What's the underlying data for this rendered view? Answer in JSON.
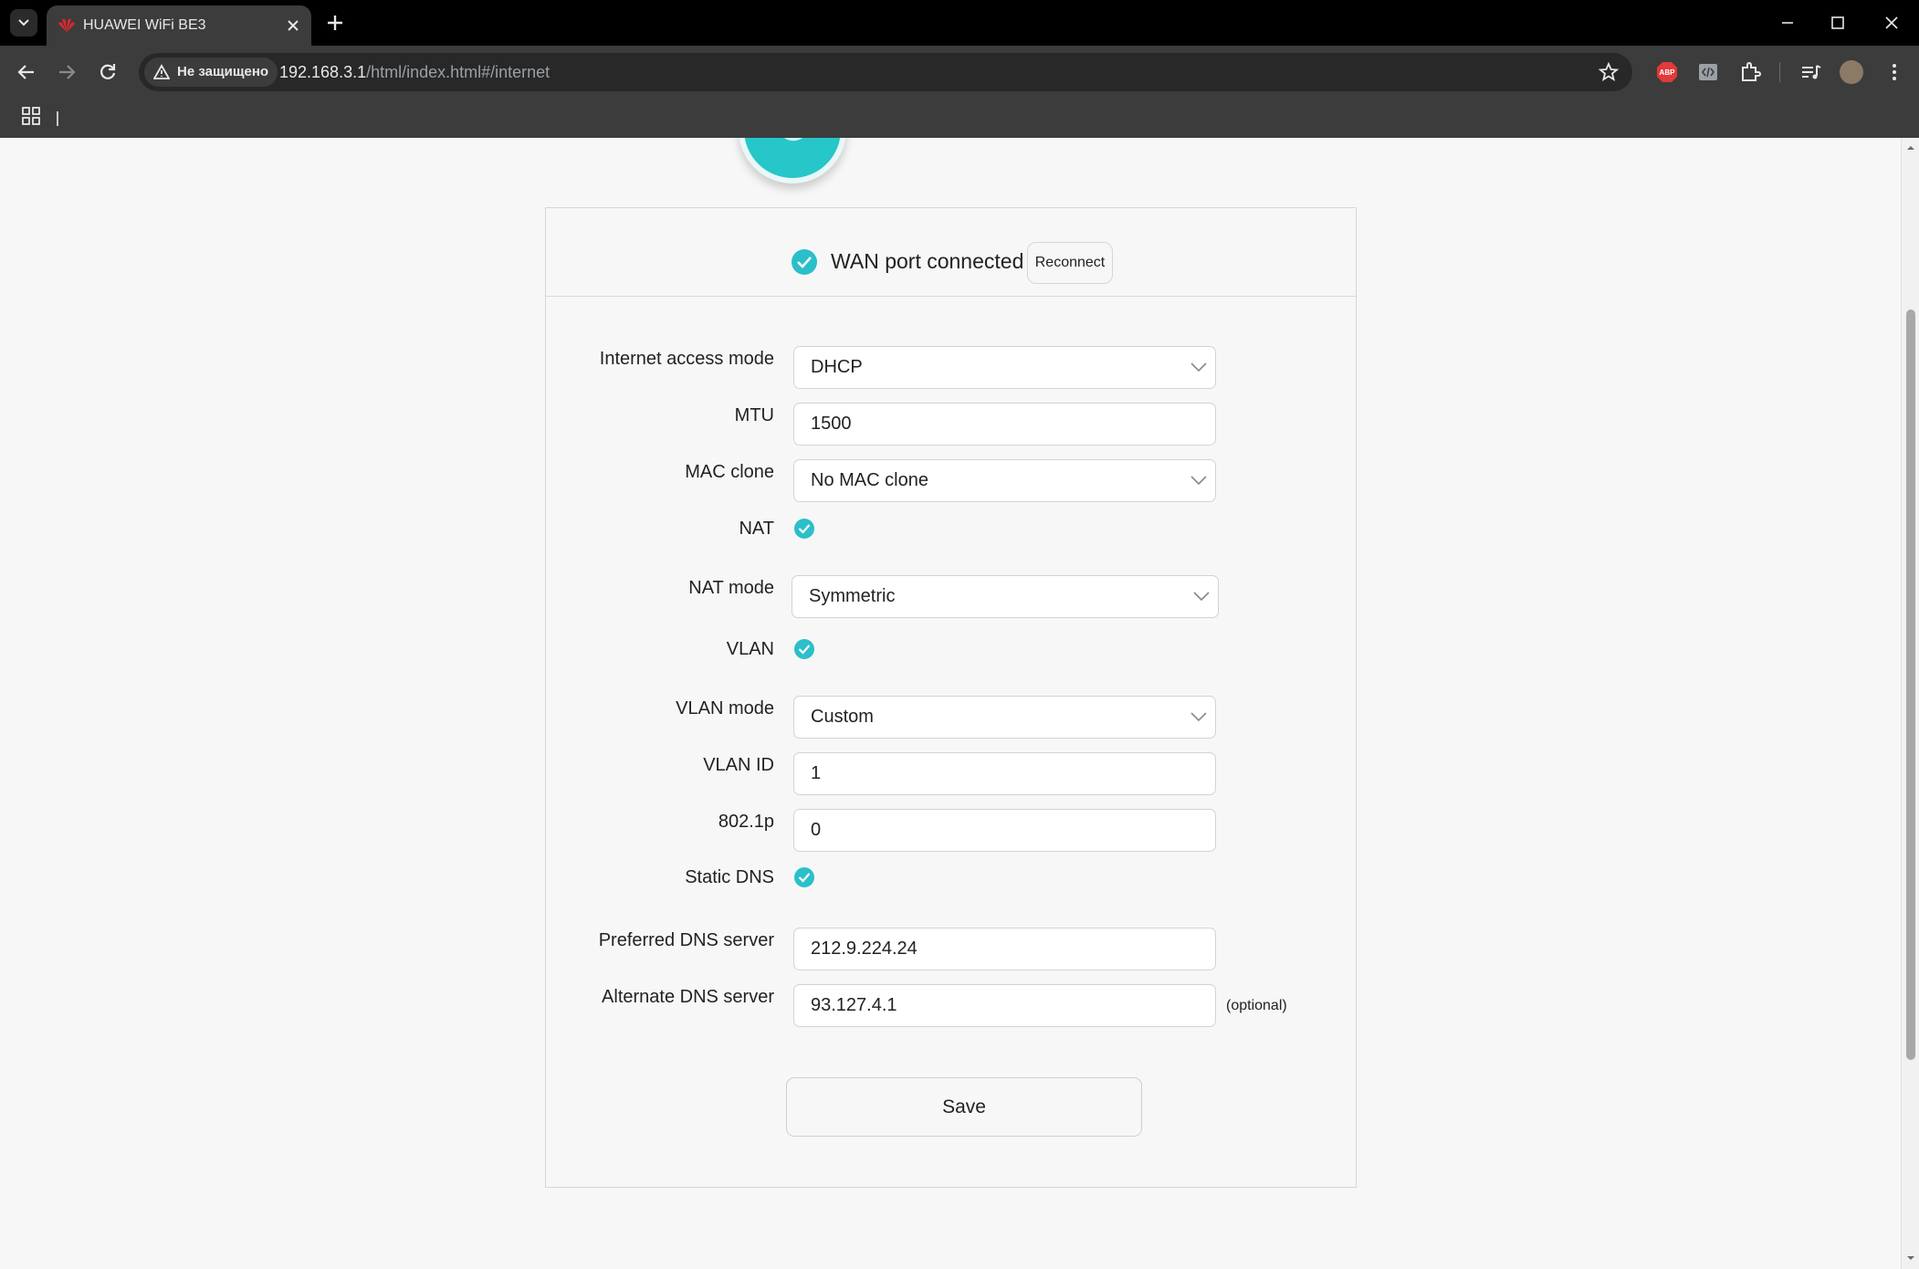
{
  "browser": {
    "tab_title": "HUAWEI WiFi BE3",
    "security_label": "Не защищено",
    "url_host": "192.168.3.1",
    "url_path": "/html/index.html#/internet"
  },
  "status": {
    "text": "WAN port connected",
    "reconnect_label": "Reconnect"
  },
  "form": {
    "access_mode_label": "Internet access mode",
    "access_mode_value": "DHCP",
    "mtu_label": "MTU",
    "mtu_value": "1500",
    "mac_clone_label": "MAC clone",
    "mac_clone_value": "No MAC clone",
    "nat_label": "NAT",
    "nat_checked": true,
    "nat_mode_label": "NAT mode",
    "nat_mode_value": "Symmetric",
    "vlan_label": "VLAN",
    "vlan_checked": true,
    "vlan_mode_label": "VLAN mode",
    "vlan_mode_value": "Custom",
    "vlan_id_label": "VLAN ID",
    "vlan_id_value": "1",
    "p8021_label": "802.1p",
    "p8021_value": "0",
    "static_dns_label": "Static DNS",
    "static_dns_checked": true,
    "preferred_dns_label": "Preferred DNS server",
    "preferred_dns_value": "212.9.224.24",
    "alternate_dns_label": "Alternate DNS server",
    "alternate_dns_value": "93.127.4.1",
    "optional_label": "(optional)",
    "save_label": "Save"
  },
  "colors": {
    "accent": "#26c6c9",
    "check": "#2bbfc9"
  }
}
